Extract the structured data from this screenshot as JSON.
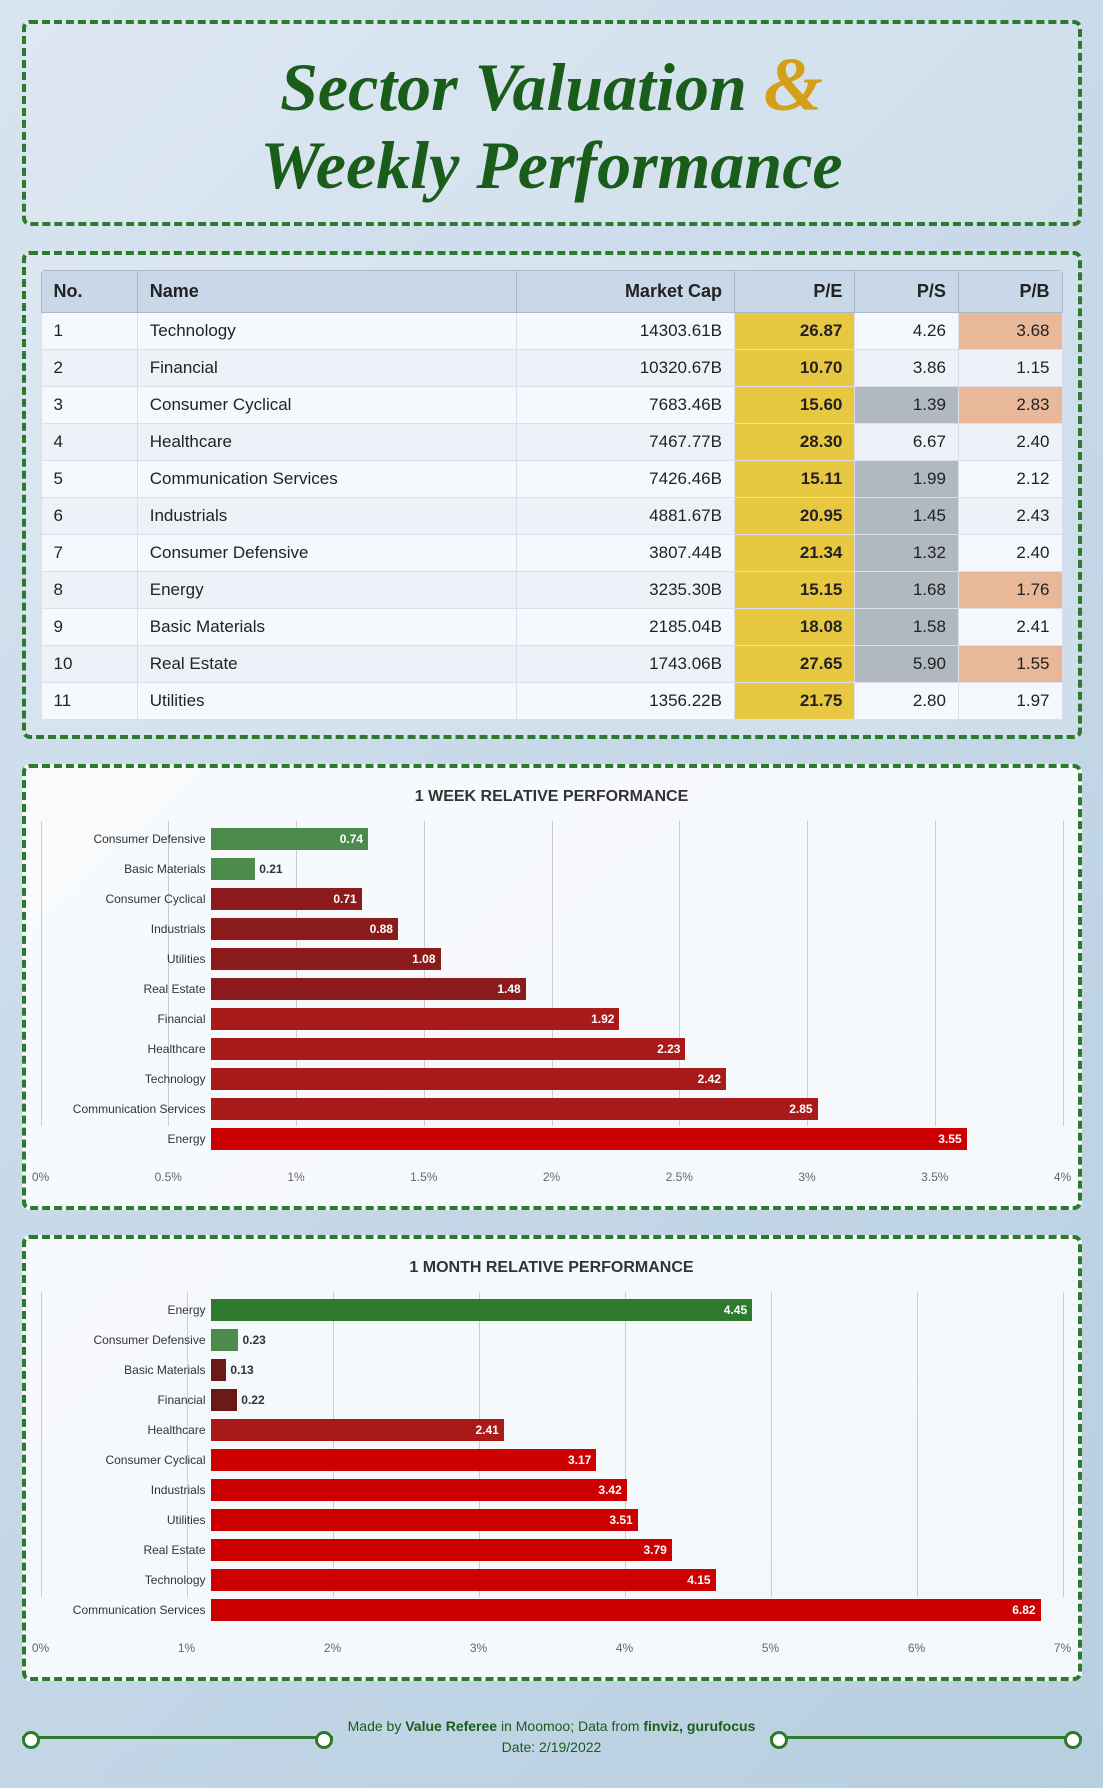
{
  "title": {
    "line1": "Sector Valuation",
    "amp": "&",
    "line2": "Weekly Performance"
  },
  "table": {
    "headers": [
      "No.",
      "Name",
      "Market Cap",
      "P/E",
      "P/S",
      "P/B"
    ],
    "rows": [
      {
        "no": 1,
        "name": "Technology",
        "market_cap": "14303.61B",
        "pe": "26.87",
        "ps": "4.26",
        "pb": "3.68",
        "pe_style": "yellow",
        "ps_style": "normal",
        "pb_style": "peach"
      },
      {
        "no": 2,
        "name": "Financial",
        "market_cap": "10320.67B",
        "pe": "10.70",
        "ps": "3.86",
        "pb": "1.15",
        "pe_style": "yellow",
        "ps_style": "normal",
        "pb_style": "normal"
      },
      {
        "no": 3,
        "name": "Consumer Cyclical",
        "market_cap": "7683.46B",
        "pe": "15.60",
        "ps": "1.39",
        "pb": "2.83",
        "pe_style": "yellow",
        "ps_style": "gray",
        "pb_style": "peach"
      },
      {
        "no": 4,
        "name": "Healthcare",
        "market_cap": "7467.77B",
        "pe": "28.30",
        "ps": "6.67",
        "pb": "2.40",
        "pe_style": "yellow",
        "ps_style": "normal",
        "pb_style": "normal"
      },
      {
        "no": 5,
        "name": "Communication Services",
        "market_cap": "7426.46B",
        "pe": "15.11",
        "ps": "1.99",
        "pb": "2.12",
        "pe_style": "yellow",
        "ps_style": "gray",
        "pb_style": "normal"
      },
      {
        "no": 6,
        "name": "Industrials",
        "market_cap": "4881.67B",
        "pe": "20.95",
        "ps": "1.45",
        "pb": "2.43",
        "pe_style": "yellow",
        "ps_style": "gray",
        "pb_style": "normal"
      },
      {
        "no": 7,
        "name": "Consumer Defensive",
        "market_cap": "3807.44B",
        "pe": "21.34",
        "ps": "1.32",
        "pb": "2.40",
        "pe_style": "yellow",
        "ps_style": "gray",
        "pb_style": "normal"
      },
      {
        "no": 8,
        "name": "Energy",
        "market_cap": "3235.30B",
        "pe": "15.15",
        "ps": "1.68",
        "pb": "1.76",
        "pe_style": "yellow",
        "ps_style": "gray",
        "pb_style": "peach"
      },
      {
        "no": 9,
        "name": "Basic Materials",
        "market_cap": "2185.04B",
        "pe": "18.08",
        "ps": "1.58",
        "pb": "2.41",
        "pe_style": "yellow",
        "ps_style": "gray",
        "pb_style": "normal"
      },
      {
        "no": 10,
        "name": "Real Estate",
        "market_cap": "1743.06B",
        "pe": "27.65",
        "ps": "5.90",
        "pb": "1.55",
        "pe_style": "yellow",
        "ps_style": "gray2",
        "pb_style": "peach"
      },
      {
        "no": 11,
        "name": "Utilities",
        "market_cap": "1356.22B",
        "pe": "21.75",
        "ps": "2.80",
        "pb": "1.97",
        "pe_style": "yellow",
        "ps_style": "normal",
        "pb_style": "normal"
      }
    ]
  },
  "week_chart": {
    "title": "1 WEEK RELATIVE PERFORMANCE",
    "bars": [
      {
        "label": "Consumer Defensive",
        "value": 0.74,
        "positive": true
      },
      {
        "label": "Basic Materials",
        "value": 0.21,
        "positive": true
      },
      {
        "label": "Consumer Cyclical",
        "value": -0.71,
        "positive": false
      },
      {
        "label": "Industrials",
        "value": -0.88,
        "positive": false
      },
      {
        "label": "Utilities",
        "value": -1.08,
        "positive": false
      },
      {
        "label": "Real Estate",
        "value": -1.48,
        "positive": false
      },
      {
        "label": "Financial",
        "value": -1.92,
        "positive": false
      },
      {
        "label": "Healthcare",
        "value": -2.23,
        "positive": false
      },
      {
        "label": "Technology",
        "value": -2.42,
        "positive": false
      },
      {
        "label": "Communication Services",
        "value": -2.85,
        "positive": false
      },
      {
        "label": "Energy",
        "value": -3.55,
        "positive": false
      }
    ],
    "x_labels": [
      "0%",
      "0.5%",
      "1%",
      "1.5%",
      "2%",
      "2.5%",
      "3%",
      "3.5%",
      "4%"
    ],
    "max_value": 4.0
  },
  "month_chart": {
    "title": "1 MONTH RELATIVE PERFORMANCE",
    "bars": [
      {
        "label": "Energy",
        "value": 4.45,
        "positive": true
      },
      {
        "label": "Consumer Defensive",
        "value": 0.23,
        "positive": true
      },
      {
        "label": "Basic Materials",
        "value": -0.13,
        "positive": false,
        "small": true
      },
      {
        "label": "Financial",
        "value": -0.22,
        "positive": false,
        "small": true
      },
      {
        "label": "Healthcare",
        "value": -2.41,
        "positive": false
      },
      {
        "label": "Consumer Cyclical",
        "value": -3.17,
        "positive": false
      },
      {
        "label": "Industrials",
        "value": -3.42,
        "positive": false
      },
      {
        "label": "Utilities",
        "value": -3.51,
        "positive": false
      },
      {
        "label": "Real Estate",
        "value": -3.79,
        "positive": false
      },
      {
        "label": "Technology",
        "value": -4.15,
        "positive": false
      },
      {
        "label": "Communication Services",
        "value": -6.82,
        "positive": false
      }
    ],
    "x_labels": [
      "0%",
      "1%",
      "2%",
      "3%",
      "4%",
      "5%",
      "6%",
      "7%"
    ],
    "max_value": 7.0
  },
  "footer": {
    "line1": "Made by Value Referee in Moomoo; Data from finviz, gurufocus",
    "line2": "Date: 2/19/2022"
  }
}
